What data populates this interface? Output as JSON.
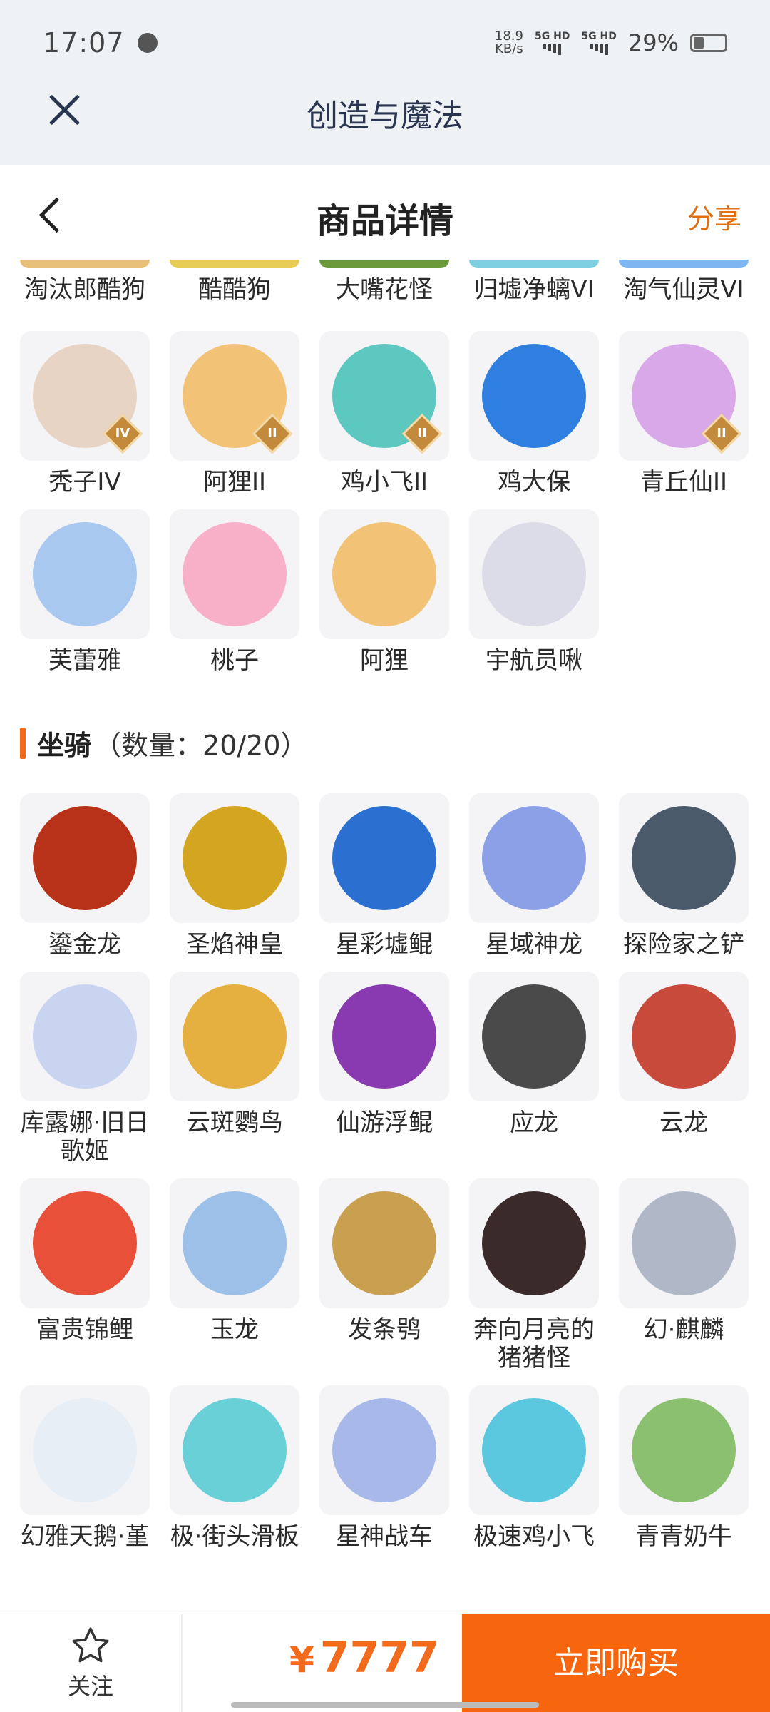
{
  "status_bar": {
    "time": "17:07",
    "speed_value": "18.9",
    "speed_unit": "KB/s",
    "net1": "5G HD",
    "net2": "5G HD",
    "battery": "29%"
  },
  "app_bar": {
    "title": "创造与魔法"
  },
  "nav": {
    "title": "商品详情",
    "share_label": "分享"
  },
  "pets_partial_row": [
    {
      "label": "淘汰郎酷狗",
      "art_color": "#e8c07a"
    },
    {
      "label": "酷酷狗",
      "art_color": "#e7cd55"
    },
    {
      "label": "大嘴花怪",
      "art_color": "#6a9a3a"
    },
    {
      "label": "归墟净螭VI",
      "art_color": "#7ed0e0"
    },
    {
      "label": "淘气仙灵VI",
      "art_color": "#7db6f0"
    }
  ],
  "pets": [
    {
      "label": "秃子IV",
      "art_color": "#e8d4c4",
      "badge": "IV"
    },
    {
      "label": "阿狸II",
      "art_color": "#f2c277",
      "badge": "II"
    },
    {
      "label": "鸡小飞II",
      "art_color": "#5cc8c0",
      "badge": "II"
    },
    {
      "label": "鸡大保",
      "art_color": "#2f7fe0",
      "badge": ""
    },
    {
      "label": "青丘仙II",
      "art_color": "#d8a8e8",
      "badge": "II"
    },
    {
      "label": "芙蕾雅",
      "art_color": "#a8c8f0",
      "badge": ""
    },
    {
      "label": "桃子",
      "art_color": "#f7b0c8",
      "badge": ""
    },
    {
      "label": "阿狸",
      "art_color": "#f2c277",
      "badge": ""
    },
    {
      "label": "宇航员啾",
      "art_color": "#dcdce8",
      "badge": ""
    }
  ],
  "mounts_section": {
    "title": "坐骑",
    "count": "（数量：20/20）"
  },
  "mounts": [
    {
      "label": "鎏金龙",
      "art_color": "#b8321a"
    },
    {
      "label": "圣焰神皇",
      "art_color": "#d4a520"
    },
    {
      "label": "星彩墟鲲",
      "art_color": "#2b6fd0"
    },
    {
      "label": "星域神龙",
      "art_color": "#8ca0e8"
    },
    {
      "label": "探险家之铲",
      "art_color": "#4a5a6a"
    },
    {
      "label": "库露娜·旧日歌姬",
      "art_color": "#c8d4f0"
    },
    {
      "label": "云斑鹦鸟",
      "art_color": "#e6b040"
    },
    {
      "label": "仙游浮鲲",
      "art_color": "#8a3ab0"
    },
    {
      "label": "应龙",
      "art_color": "#4a4a4a"
    },
    {
      "label": "云龙",
      "art_color": "#c84a3a"
    },
    {
      "label": "富贵锦鲤",
      "art_color": "#e8503a"
    },
    {
      "label": "玉龙",
      "art_color": "#9cc0e8"
    },
    {
      "label": "发条鸮",
      "art_color": "#c8a050"
    },
    {
      "label": "奔向月亮的猪猪怪",
      "art_color": "#3a2a2a"
    },
    {
      "label": "幻·麒麟",
      "art_color": "#b0b8c8"
    },
    {
      "label": "幻雅天鹅·堇",
      "art_color": "#e8eef6"
    },
    {
      "label": "极·街头滑板",
      "art_color": "#6ad0d8"
    },
    {
      "label": "星神战车",
      "art_color": "#a8b8e8"
    },
    {
      "label": "极速鸡小飞",
      "art_color": "#5cc8e0"
    },
    {
      "label": "青青奶牛",
      "art_color": "#8ac070"
    }
  ],
  "bottom_bar": {
    "follow_label": "关注",
    "currency": "¥",
    "price": "7777",
    "buy_label": "立即购买"
  },
  "colors": {
    "accent": "#f7650e",
    "share": "#e07012",
    "header_bg": "#eef2f5",
    "title_dark": "#2a3550"
  }
}
